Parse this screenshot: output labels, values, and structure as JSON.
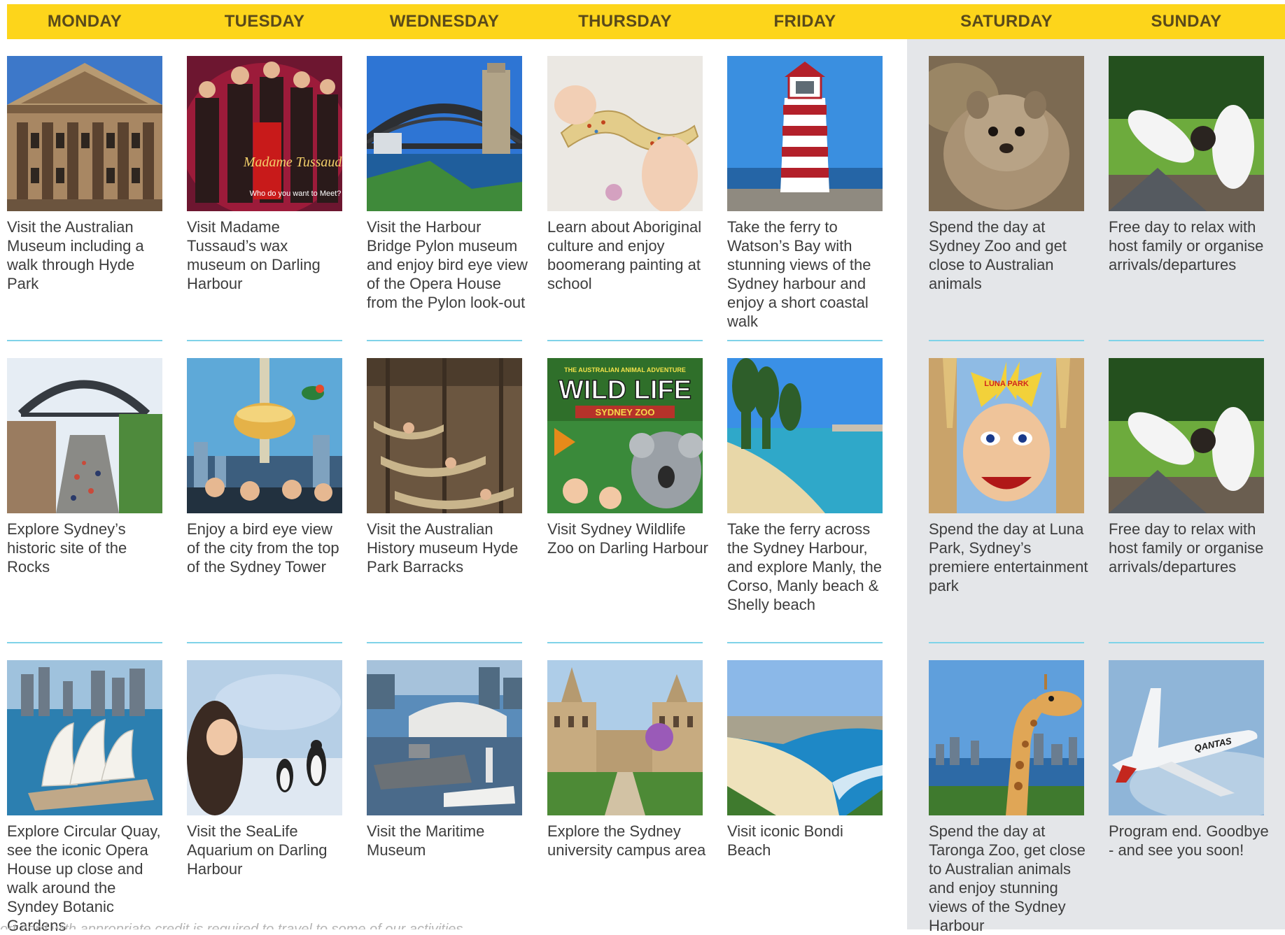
{
  "days": [
    "MONDAY",
    "TUESDAY",
    "WEDNESDAY",
    "THURSDAY",
    "FRIDAY",
    "SATURDAY",
    "SUNDAY"
  ],
  "activities": [
    [
      "Visit the Australian Museum including a walk through Hyde Park",
      "Explore Sydney’s historic site of the Rocks",
      "Explore Circular Quay, see the iconic Opera House up close and walk around the Syndey Botanic Gardens"
    ],
    [
      "Visit Madame Tussaud’s wax museum on Darling Harbour",
      "Enjoy a bird eye view of the city from the top of the Sydney Tower",
      "Visit the SeaLife Aquarium on Darling Harbour"
    ],
    [
      "Visit the Harbour Bridge Pylon museum and enjoy bird eye view of the Opera House from the Pylon look-out",
      "Visit the Australian History museum Hyde Park Barracks",
      "Visit the Maritime Museum"
    ],
    [
      "Learn about Aboriginal culture and enjoy boomerang painting at school",
      "Visit Sydney Wildlife Zoo on Darling Harbour",
      "Explore the Sydney university campus area"
    ],
    [
      "Take the ferry to Watson’s Bay with stunning views of the Sydney harbour and enjoy a short coastal walk",
      "Take the ferry across the Sydney Harbour, and explore Manly, the Corso, Manly beach & Shelly beach",
      "Visit iconic Bondi Beach"
    ],
    [
      "Spend the day at Sydney Zoo and get close to Australian animals",
      "Spend the day at Luna Park, Sydney’s premiere entertainment park",
      "Spend the day at Taronga Zoo, get close to Australian animals and enjoy stunning views of the Sydney Harbour"
    ],
    [
      "Free day to relax with host family or organise arrivals/departures",
      "Free day to relax with host family or organise arrivals/departures",
      "Program end. Goodbye - and see you soon!"
    ]
  ],
  "image_text": {
    "tussauds": "Madame Tussauds",
    "tussauds_sub": "Who do you want to Meet?",
    "wildlife_top": "THE AUSTRALIAN ANIMAL ADVENTURE",
    "wildlife": "WILD LIFE",
    "wildlife_sub": "SYDNEY ZOO",
    "lunapark": "LUNA PARK",
    "qantas": "QANTAS"
  },
  "footnote": "ort card with appropriate credit is required to travel to some of our activities",
  "colors": {
    "header": "#fdd51b",
    "weekend": "#e4e6e9",
    "divider": "#7fd3e8"
  }
}
